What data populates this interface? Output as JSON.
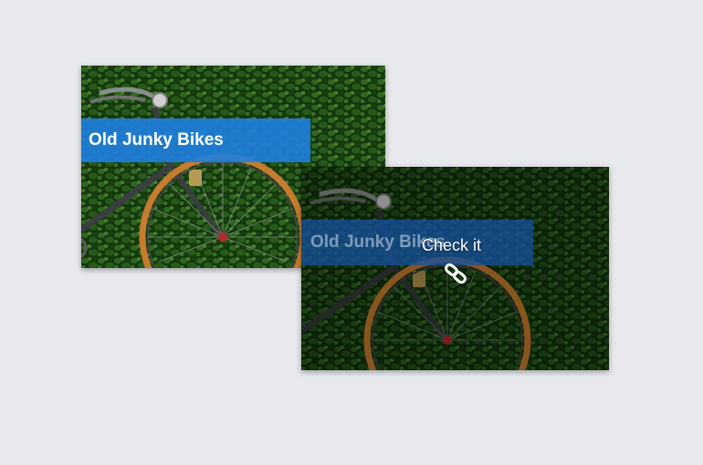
{
  "colors": {
    "background": "#e8e9ed",
    "caption_active": "#1e7fe0",
    "caption_dimmed": "#1652a0"
  },
  "cards": [
    {
      "title": "Old Junky Bikes",
      "state": "default"
    },
    {
      "title": "Old Junky Bikes",
      "state": "hover",
      "cta_label": "Check it",
      "cta_icon": "link-icon"
    }
  ]
}
